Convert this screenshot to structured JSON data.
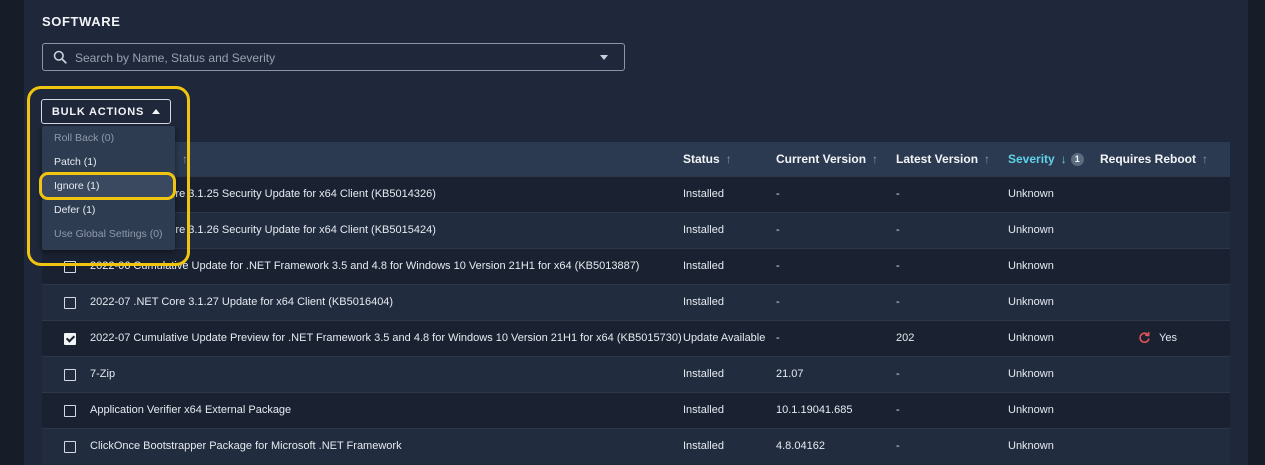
{
  "section_title": "SOFTWARE",
  "search": {
    "placeholder": "Search by Name, Status and Severity",
    "value": ""
  },
  "bulk_actions": {
    "label": "BULK ACTIONS",
    "menu": [
      {
        "label": "Roll Back (0)",
        "enabled": false
      },
      {
        "label": "Patch (1)",
        "enabled": true
      },
      {
        "label": "Ignore (1)",
        "enabled": true,
        "highlighted": true
      },
      {
        "label": "Defer (1)",
        "enabled": true
      },
      {
        "label": "Use Global Settings (0)",
        "enabled": false
      }
    ]
  },
  "table": {
    "columns": {
      "status": "Status",
      "current_version": "Current Version",
      "latest_version": "Latest Version",
      "severity": "Severity",
      "severity_sort_badge": "1",
      "requires_reboot": "Requires Reboot"
    },
    "rows": [
      {
        "name": "2022-06 .NET Core 3.1.25 Security Update for x64 Client (KB5014326)",
        "status": "Installed",
        "current": "-",
        "latest": "-",
        "severity": "Unknown",
        "reboot": "",
        "checked": false
      },
      {
        "name": "2022-06 .NET Core 3.1.26 Security Update for x64 Client (KB5015424)",
        "status": "Installed",
        "current": "-",
        "latest": "-",
        "severity": "Unknown",
        "reboot": "",
        "checked": false
      },
      {
        "name": "2022-06 Cumulative Update for .NET Framework 3.5 and 4.8 for Windows 10 Version 21H1 for x64 (KB5013887)",
        "status": "Installed",
        "current": "-",
        "latest": "-",
        "severity": "Unknown",
        "reboot": "",
        "checked": false
      },
      {
        "name": "2022-07 .NET Core 3.1.27 Update for x64 Client (KB5016404)",
        "status": "Installed",
        "current": "-",
        "latest": "-",
        "severity": "Unknown",
        "reboot": "",
        "checked": false
      },
      {
        "name": "2022-07 Cumulative Update Preview for .NET Framework 3.5 and 4.8 for Windows 10 Version 21H1 for x64 (KB5015730)",
        "status": "Update Available",
        "current": "-",
        "latest": "202",
        "severity": "Unknown",
        "reboot": "Yes",
        "checked": true
      },
      {
        "name": "7-Zip",
        "status": "Installed",
        "current": "21.07",
        "latest": "-",
        "severity": "Unknown",
        "reboot": "",
        "checked": false
      },
      {
        "name": "Application Verifier x64 External Package",
        "status": "Installed",
        "current": "10.1.19041.685",
        "latest": "-",
        "severity": "Unknown",
        "reboot": "",
        "checked": false
      },
      {
        "name": "ClickOnce Bootstrapper Package for Microsoft .NET Framework",
        "status": "Installed",
        "current": "4.8.04162",
        "latest": "-",
        "severity": "Unknown",
        "reboot": "",
        "checked": false
      }
    ]
  },
  "colors": {
    "accent": "#5fd2e8",
    "highlight": "#f1c40f",
    "reboot_icon": "#e05555",
    "background": "#1e283a"
  },
  "icons": {
    "search": "search-icon",
    "dropdown": "chevron-down-icon",
    "sort": "arrow-up-icon",
    "reboot": "restart-icon"
  }
}
